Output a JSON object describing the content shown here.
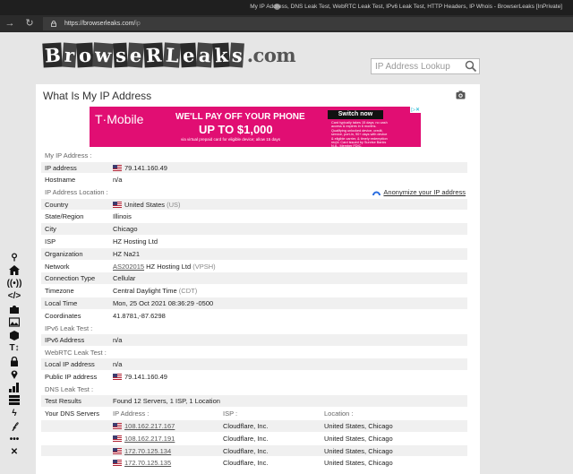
{
  "window": {
    "title": "My IP Address, DNS Leak Test, WebRTC Leak Test, IPv6 Leak Test, HTTP Headers, IP Whois - BrowserLeaks [InPrivate]"
  },
  "addressbar": {
    "url_host": "https://browserleaks.com/",
    "url_path": "ip"
  },
  "site": {
    "logo": "BrowseRLeaks.com",
    "search_placeholder": "IP Address Lookup"
  },
  "page": {
    "title": "What Is My IP Address"
  },
  "ad": {
    "brand": "T·Mobile",
    "headline1": "WE'LL PAY OFF YOUR PHONE",
    "headline2": "UP TO $1,000",
    "subline": "via virtual prepaid card for eligible device; allow 15 days",
    "cta": "Switch now",
    "fine_print": "Card typically takes 15 days; no cash access & expires in 6 months. Qualifying unlocked device, credit, service, port-in, 90+ days with device & eligible carrier, & timely redemption req'd. Card issued by Sunrise Banks N.A., Member FDIC."
  },
  "sections": {
    "my_ip": {
      "label": "My IP Address :",
      "ip_label": "IP address",
      "ip": "79.141.160.49",
      "host_label": "Hostname",
      "host": "n/a"
    },
    "location": {
      "label": "IP Address Location :",
      "anonymize": "Anonymize your IP address",
      "country_label": "Country",
      "country": "United States",
      "country_code": "(US)",
      "region_label": "State/Region",
      "region": "Illinois",
      "city_label": "City",
      "city": "Chicago",
      "isp_label": "ISP",
      "isp": "HZ Hosting Ltd",
      "org_label": "Organization",
      "org": "HZ Na21",
      "network_label": "Network",
      "asn": "AS202015",
      "network": "HZ Hosting Ltd",
      "network_code": "(VPSH)",
      "conn_label": "Connection Type",
      "conn": "Cellular",
      "tz_label": "Timezone",
      "tz": "Central Daylight Time",
      "tz_code": "(CDT)",
      "time_label": "Local Time",
      "time": "Mon, 25 Oct 2021 08:36:29 -0500",
      "coord_label": "Coordinates",
      "coord": "41.8781,-87.6298"
    },
    "ipv6": {
      "label": "IPv6 Leak Test :",
      "row_label": "IPv6 Address",
      "value": "n/a"
    },
    "webrtc": {
      "label": "WebRTC Leak Test :",
      "local_label": "Local IP address",
      "local": "n/a",
      "public_label": "Public IP address",
      "public": "79.141.160.49"
    },
    "dns": {
      "label": "DNS Leak Test :",
      "results_label": "Test Results",
      "results": "Found 12 Servers, 1 ISP, 1 Location",
      "servers_label": "Your DNS Servers",
      "col_ip": "IP Address :",
      "col_isp": "ISP :",
      "col_loc": "Location :",
      "servers": [
        {
          "ip": "108.162.217.167",
          "isp": "Cloudflare, Inc.",
          "loc": "United States, Chicago"
        },
        {
          "ip": "108.162.217.191",
          "isp": "Cloudflare, Inc.",
          "loc": "United States, Chicago"
        },
        {
          "ip": "172.70.125.134",
          "isp": "Cloudflare, Inc.",
          "loc": "United States, Chicago"
        },
        {
          "ip": "172.70.125.135",
          "isp": "Cloudflare, Inc.",
          "loc": "United States, Chicago"
        }
      ]
    }
  },
  "toolbar_icons": [
    "pin-icon",
    "home-icon",
    "broadcast-icon",
    "code-icon",
    "puzzle-icon",
    "image-icon",
    "cube-icon",
    "text-height-icon",
    "lock-icon",
    "location-pin-icon",
    "bar-chart-icon",
    "server-icon",
    "flash-icon",
    "font-icon",
    "more-icon",
    "tools-icon"
  ]
}
